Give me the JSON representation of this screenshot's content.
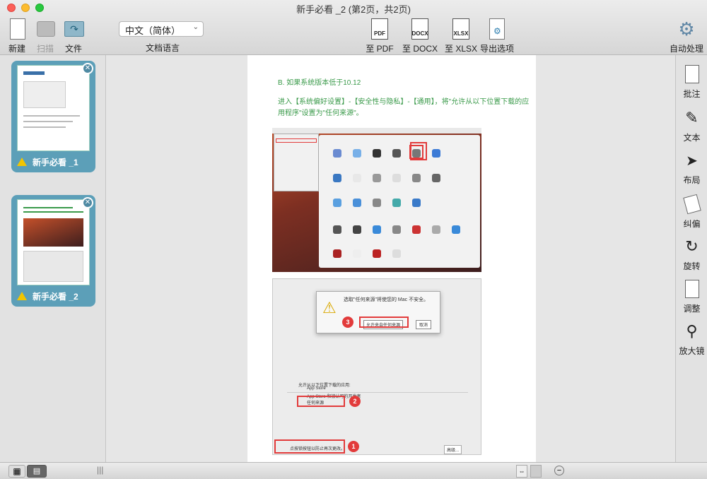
{
  "window": {
    "title": "新手必看 _2 (第2页，共2页)"
  },
  "toolbar": {
    "new_label": "新建",
    "scan_label": "扫描",
    "file_label": "文件",
    "language_value": "中文（简体）",
    "language_label": "文档语言",
    "pdf_label": "至 PDF",
    "docx_label": "至 DOCX",
    "xlsx_label": "至 XLSX",
    "export_label": "导出选项",
    "auto_label": "自动处理",
    "pdf_icon_text": "PDF",
    "docx_icon_text": "DOCX",
    "xlsx_icon_text": "XLSX"
  },
  "pages": [
    {
      "label": "新手必看 _1"
    },
    {
      "label": "新手必看 _2"
    }
  ],
  "document": {
    "heading": "B. 如果系统版本低于10.12",
    "paragraph": "进入【系统偏好设置】-【安全性与隐私】-【通用】，将\"允许从以下位置下载的应用程序\"设置为\"任何来源\"。",
    "dialog_text": "选取\"任何来源\"将使您的 Mac 不安全。",
    "allow_button": "允许来自任何来源",
    "cancel_button": "取消",
    "section_title": "允许从以下位置下载的应用:",
    "opt1": "App Store",
    "opt2": "App Store 和被认可的开发者",
    "opt3": "任何来源",
    "lock_text": "点按锁按钮以防止再次更改。",
    "advanced": "高级...",
    "step1": "1",
    "step2": "2",
    "step3": "3"
  },
  "right_tools": [
    {
      "label": "批注"
    },
    {
      "label": "文本"
    },
    {
      "label": "布局"
    },
    {
      "label": "纠偏"
    },
    {
      "label": "旋转"
    },
    {
      "label": "调整"
    },
    {
      "label": "放大镜"
    }
  ],
  "colors": {
    "accent": "#5c9fb8",
    "text_green": "#3a9a4a",
    "red": "#e23b3b"
  }
}
